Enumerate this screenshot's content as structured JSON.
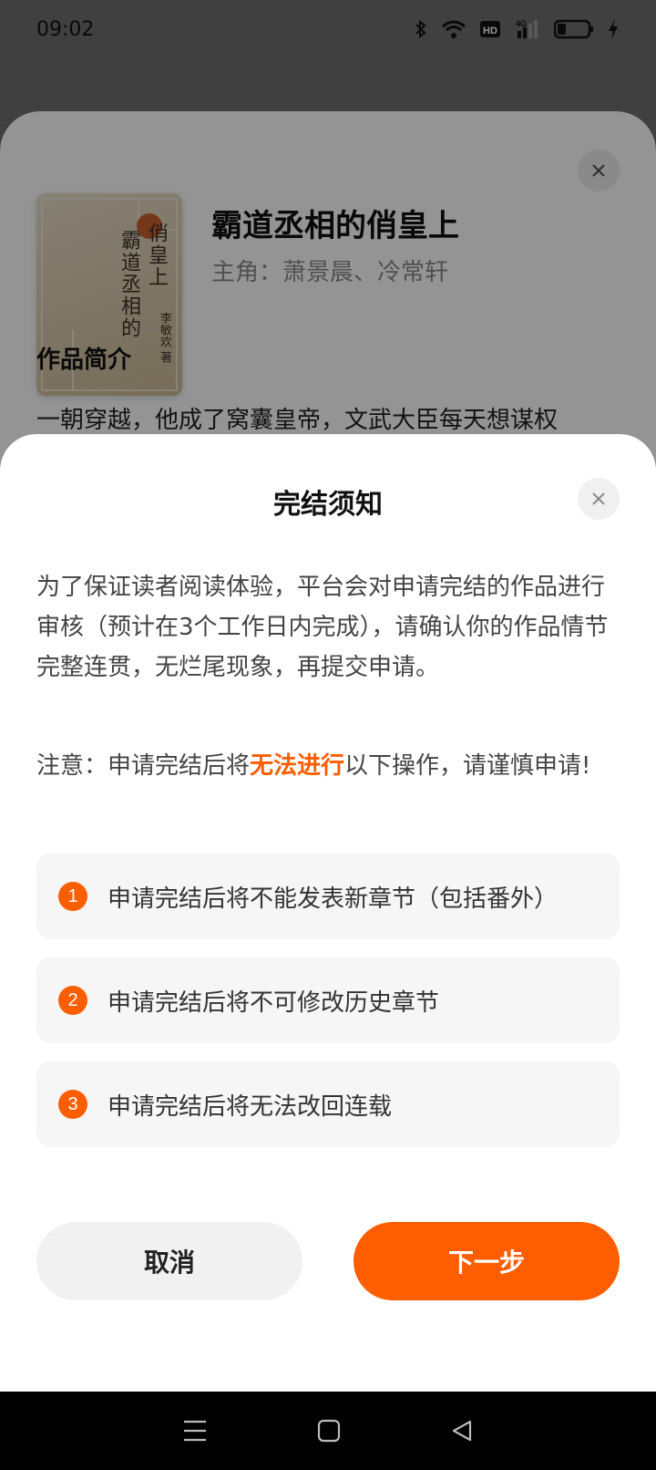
{
  "status_bar": {
    "time": "09:02",
    "icons": [
      "bluetooth-icon",
      "wifi-icon",
      "hd-icon",
      "4g-signal-icon",
      "battery-icon",
      "charging-icon"
    ]
  },
  "book": {
    "cover": {
      "title_line1": "俏皇上",
      "title_line2": "霸道丞相的",
      "author": "李敏欢 著"
    },
    "title": "霸道丞相的俏皇上",
    "roles": "主角：萧景晨、冷常轩",
    "section_title": "作品简介",
    "intro_snippet": "一朝穿越，他成了窝囊皇帝，文武大臣每天想谋权"
  },
  "modal": {
    "title": "完结须知",
    "description": "为了保证读者阅读体验，平台会对申请完结的作品进行审核（预计在3个工作日内完成），请确认你的作品情节完整连贯，无烂尾现象，再提交申请。",
    "notice_prefix": "注意：申请完结后将",
    "notice_highlight": "无法进行",
    "notice_suffix": "以下操作，请谨慎申请!",
    "items": [
      {
        "num": "1",
        "text": "申请完结后将不能发表新章节（包括番外）"
      },
      {
        "num": "2",
        "text": "申请完结后将不可修改历史章节"
      },
      {
        "num": "3",
        "text": "申请完结后将无法改回连载"
      }
    ],
    "cancel_label": "取消",
    "next_label": "下一步"
  },
  "colors": {
    "accent": "#fe5e00",
    "overlay": "rgba(0,0,0,0.42)"
  },
  "nav_bar": {
    "icons": [
      "menu-icon",
      "home-icon",
      "back-icon"
    ]
  }
}
